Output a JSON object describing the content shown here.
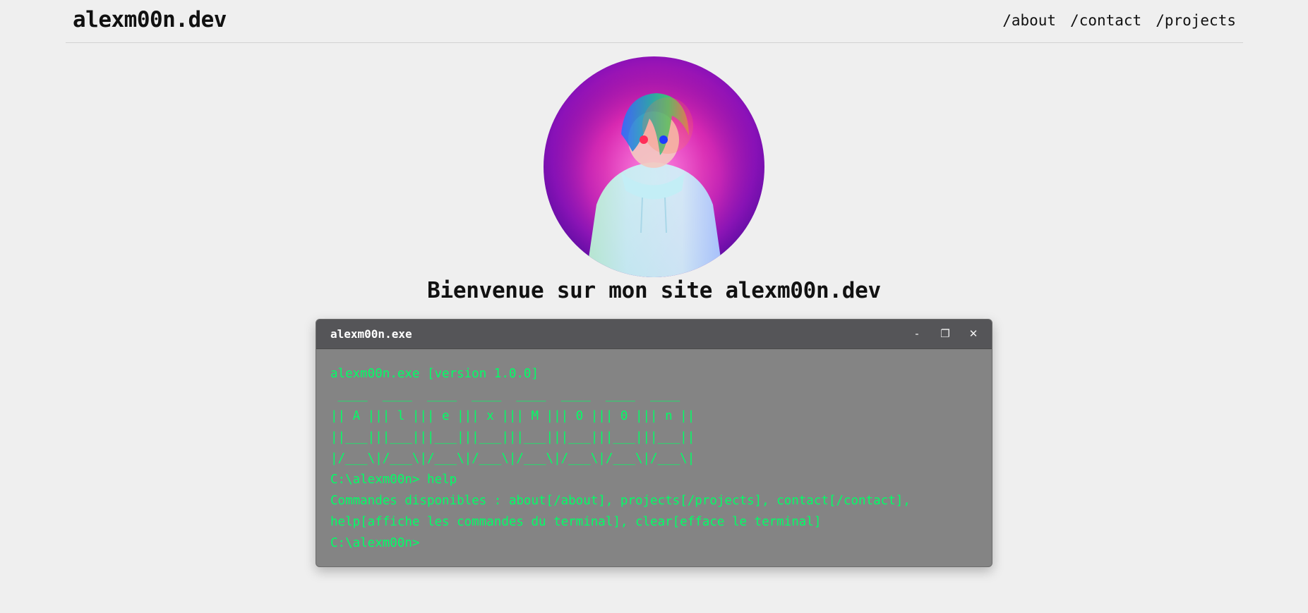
{
  "header": {
    "site_title": "alexm00n.dev",
    "nav": [
      {
        "label": "/about"
      },
      {
        "label": "/contact"
      },
      {
        "label": "/projects"
      }
    ]
  },
  "avatar": {
    "description_icon": "avatar-illustration-icon"
  },
  "welcome": "Bienvenue sur mon site alexm00n.dev",
  "terminal": {
    "title": "alexm00n.exe",
    "controls": {
      "minimize": "-",
      "maximize": "❐",
      "close": "✕"
    },
    "lines": [
      "alexm00n.exe [version 1.0.0]",
      " ____  ____  ____  ____  ____  ____  ____  ____",
      "|| A ||| l ||| e ||| x ||| M ||| 0 ||| 0 ||| n ||",
      "||___|||___|||___|||___|||___|||___|||___|||___||",
      "|/___\\|/___\\|/___\\|/___\\|/___\\|/___\\|/___\\|/___\\|",
      "C:\\alexm00n> help",
      "Commandes disponibles : about[/about], projects[/projects], contact[/contact],",
      "help[affiche les commandes du terminal], clear[efface le terminal]"
    ],
    "prompt": "C:\\alexm00n>",
    "input_value": ""
  },
  "colors": {
    "background": "#efefef",
    "terminal_bg": "#848484",
    "titlebar_bg": "#555558",
    "terminal_text": "#00ff66"
  }
}
